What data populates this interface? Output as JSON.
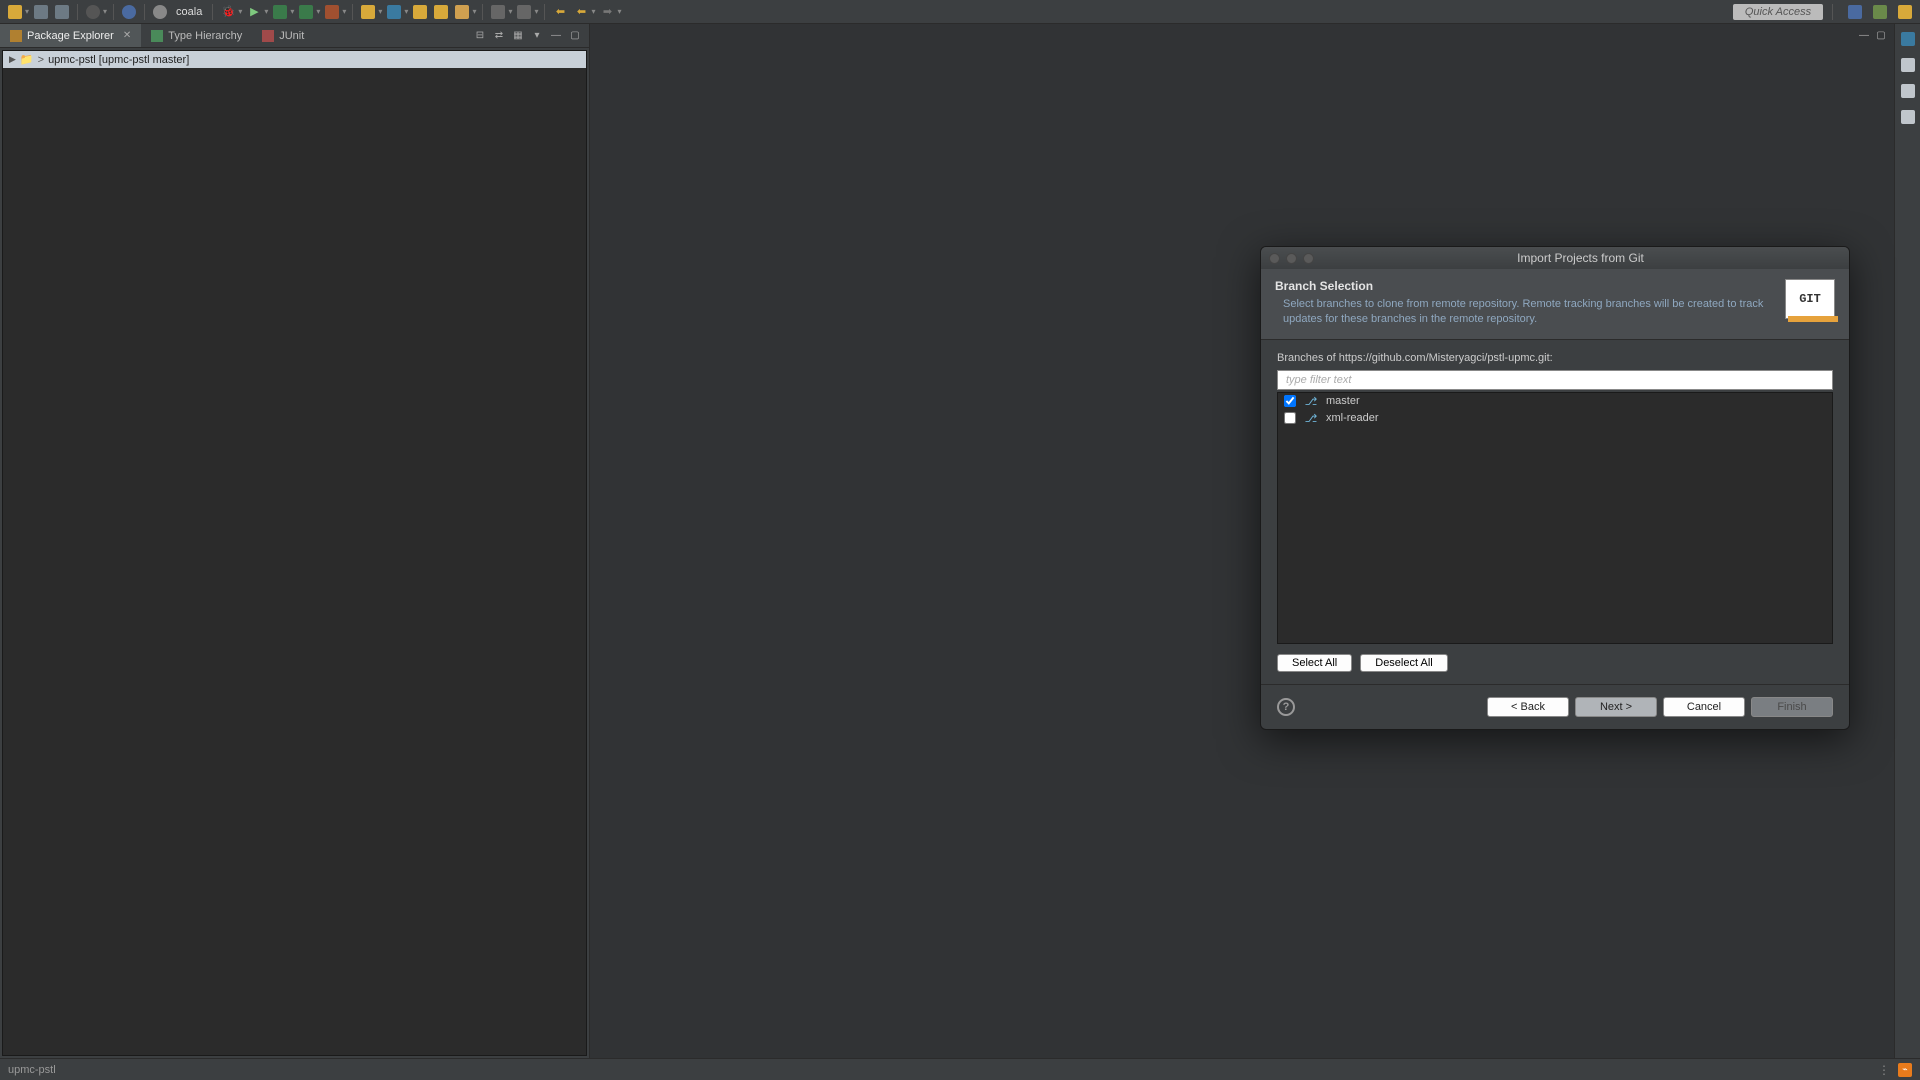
{
  "toolbar": {
    "coala_label": "coala",
    "quick_access": "Quick Access"
  },
  "tabs": {
    "package_explorer": "Package Explorer",
    "type_hierarchy": "Type Hierarchy",
    "junit": "JUnit"
  },
  "tree": {
    "project": "upmc-pstl [upmc-pstl master]"
  },
  "dialog": {
    "title": "Import Projects from Git",
    "heading": "Branch Selection",
    "description": "Select branches to clone from remote repository. Remote tracking branches will be created to track updates for these branches in the remote repository.",
    "branches_label": "Branches of https://github.com/Misteryagci/pstl-upmc.git:",
    "filter_placeholder": "type filter text",
    "branches": [
      {
        "name": "master",
        "checked": true
      },
      {
        "name": "xml-reader",
        "checked": false
      }
    ],
    "select_all": "Select All",
    "deselect_all": "Deselect All",
    "back": "< Back",
    "next": "Next >",
    "cancel": "Cancel",
    "finish": "Finish",
    "git_logo": "GIT"
  },
  "statusbar": {
    "project": "upmc-pstl"
  }
}
